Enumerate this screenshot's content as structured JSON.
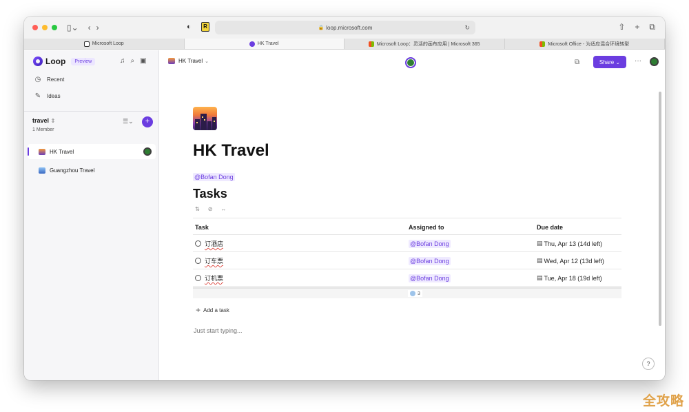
{
  "browser": {
    "url": "loop.microsoft.com",
    "tabs": [
      {
        "label": "Microsoft Loop"
      },
      {
        "label": "HK Travel"
      },
      {
        "label": "Microsoft Loop：灵活的画布应用 | Microsoft 365"
      },
      {
        "label": "Microsoft Office - 为适应混合环境转型"
      }
    ],
    "r_badge": "R"
  },
  "sidebar": {
    "brand": "Loop",
    "badge": "Preview",
    "nav": [
      {
        "label": "Recent",
        "icon": "clock-icon"
      },
      {
        "label": "Ideas",
        "icon": "idea-icon"
      }
    ],
    "workspace": {
      "name": "travel",
      "members": "1 Member"
    },
    "pages": [
      {
        "label": "HK Travel"
      },
      {
        "label": "Guangzhou Travel"
      }
    ]
  },
  "header": {
    "crumb": "HK Travel",
    "share_label": "Share"
  },
  "page": {
    "title": "HK Travel",
    "mention": "@Bofan Dong",
    "tasks_heading": "Tasks",
    "columns": {
      "task": "Task",
      "assigned": "Assigned to",
      "due": "Due date"
    },
    "rows": [
      {
        "task": "订酒店",
        "assigned": "@Bofan Dong",
        "due": "Thu, Apr 13 (14d left)"
      },
      {
        "task": "订车票",
        "assigned": "@Bofan Dong",
        "due": "Wed, Apr 12 (13d left)"
      },
      {
        "task": "订机票",
        "assigned": "@Bofan Dong",
        "due": "Tue, Apr 18 (19d left)"
      }
    ],
    "count": "3",
    "add_task": "Add a task",
    "placeholder": "Just start typing..."
  },
  "help": "?",
  "watermark": "全攻略",
  "colors": {
    "accent": "#6b3de0",
    "presence": "#2e7d32"
  }
}
